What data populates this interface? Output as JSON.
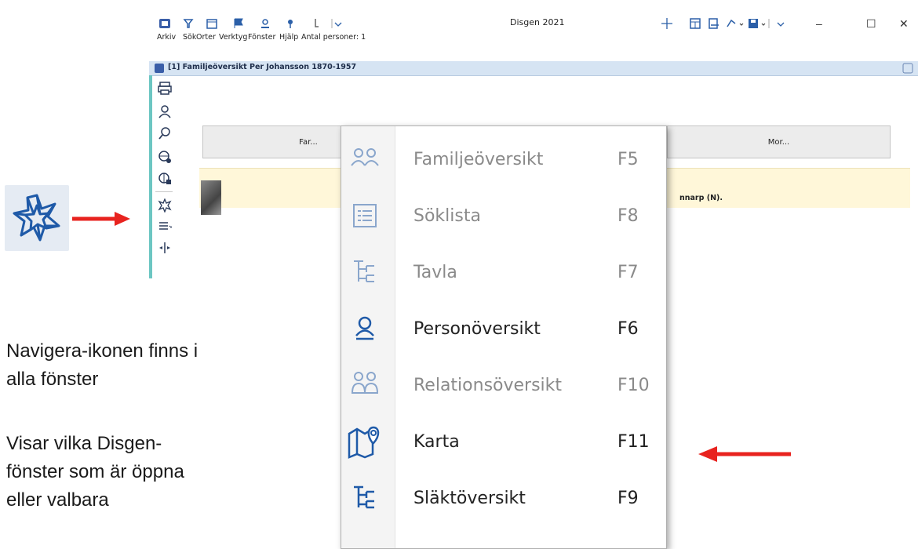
{
  "window": {
    "title": "Disgen 2021",
    "menu": [
      "Arkiv",
      "Sök",
      "Orter",
      "Verktyg",
      "Fönster",
      "Hjälp",
      "Antal personer: 1"
    ],
    "doc_title": "[1] Familjeöversikt Per Johansson 1870-1957",
    "far_label": "Far...",
    "mor_label": "Mor...",
    "info_text": "nnarp (N)."
  },
  "navigate_menu": {
    "items": [
      {
        "label": "Familjeöversikt",
        "key": "F5",
        "enabled": false,
        "icon": "people-icon"
      },
      {
        "label": "Söklista",
        "key": "F8",
        "enabled": false,
        "icon": "list-icon"
      },
      {
        "label": "Tavla",
        "key": "F7",
        "enabled": false,
        "icon": "tree-chart-icon"
      },
      {
        "label": "Personöversikt",
        "key": "F6",
        "enabled": true,
        "icon": "person-icon"
      },
      {
        "label": "Relationsöversikt",
        "key": "F10",
        "enabled": false,
        "icon": "relations-icon"
      },
      {
        "label": "Karta",
        "key": "F11",
        "enabled": true,
        "icon": "map-pin-icon"
      },
      {
        "label": "Släktöversikt",
        "key": "F9",
        "enabled": true,
        "icon": "family-tree-icon"
      }
    ]
  },
  "caption": {
    "line1": "Navigera-ikonen finns i",
    "line2": "alla fönster",
    "line3": "Visar vilka Disgen-",
    "line4": "fönster som är öppna",
    "line5": "eller valbara"
  },
  "colors": {
    "arrow": "#e8231f",
    "nav_icon": "#1f5aa8",
    "accent": "#2b5fa8"
  }
}
